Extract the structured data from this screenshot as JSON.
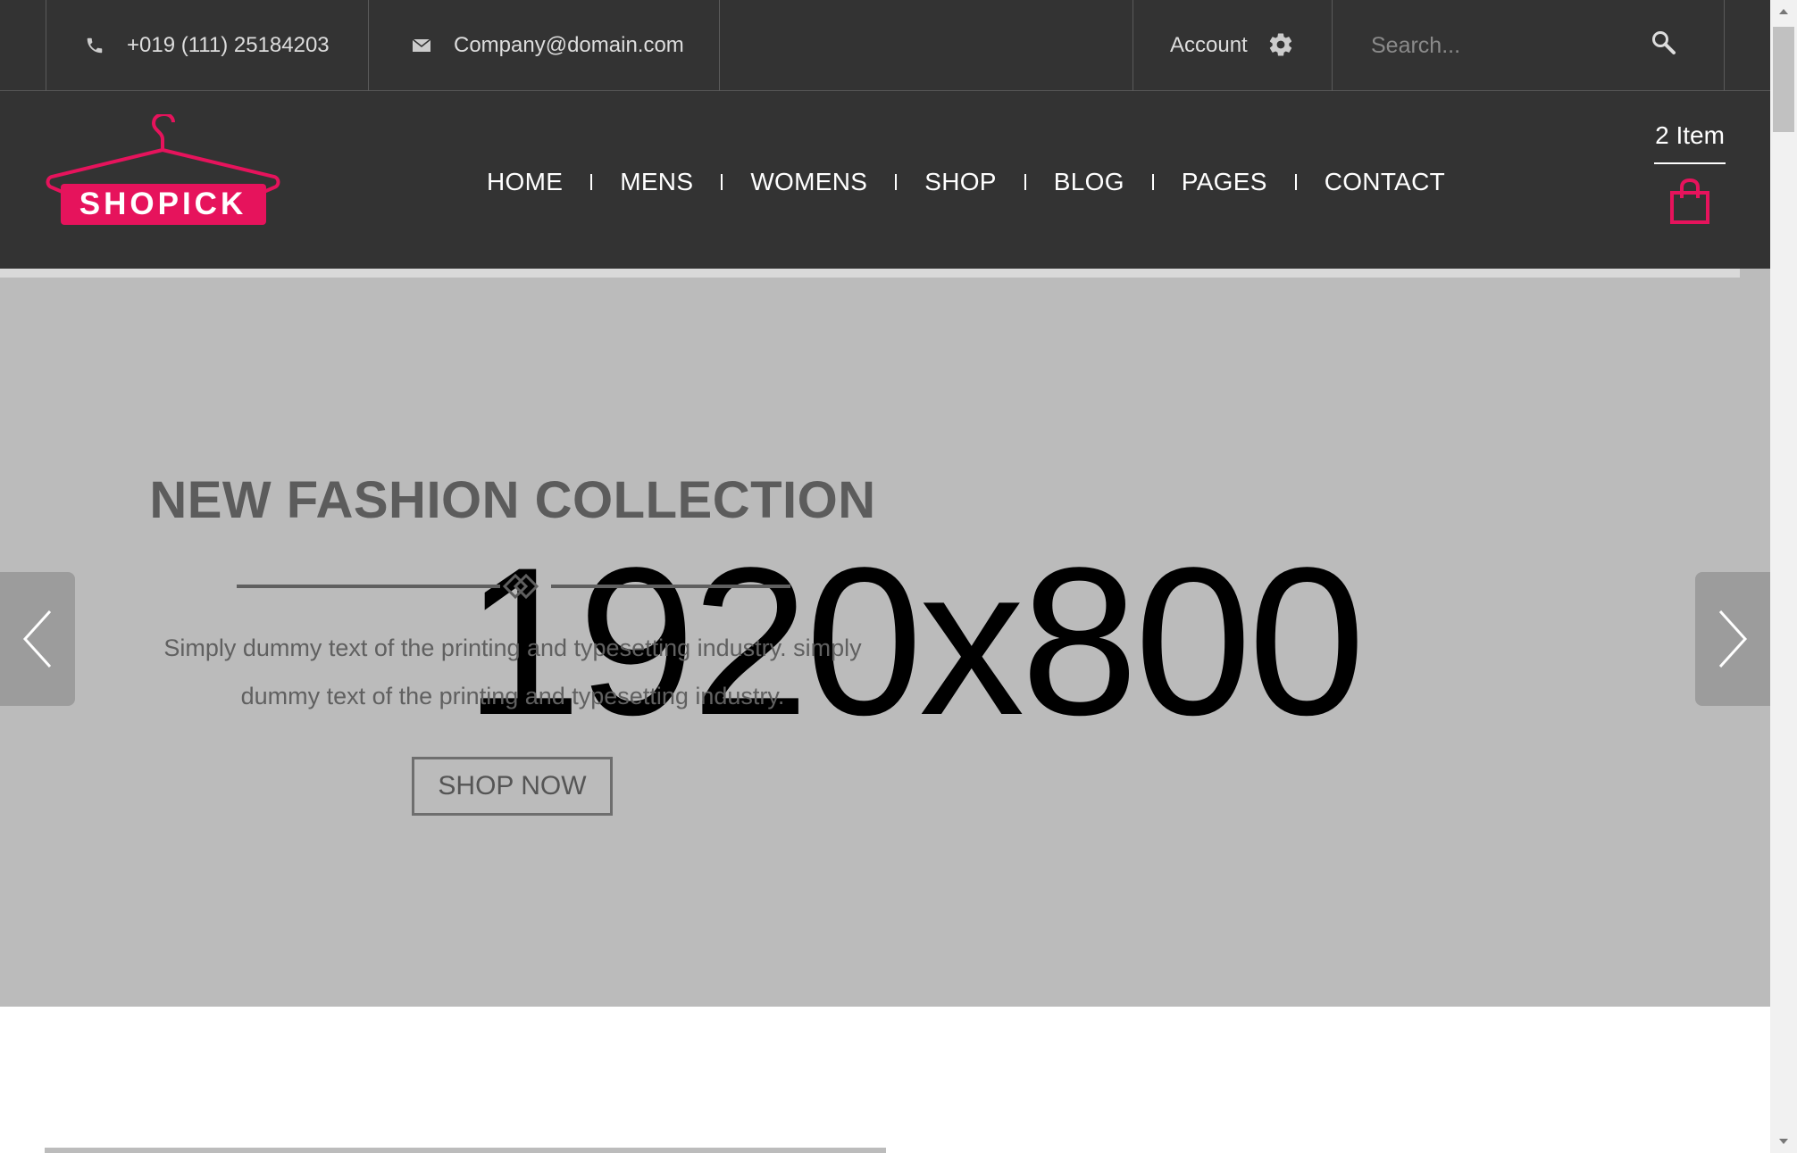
{
  "topbar": {
    "phone": "+019 (111) 25184203",
    "email": "Company@domain.com",
    "account_label": "Account",
    "search_placeholder": "Search..."
  },
  "header": {
    "logo_text": "SHOPICK",
    "nav": [
      "HOME",
      "MENS",
      "WOMENS",
      "SHOP",
      "BLOG",
      "PAGES",
      "CONTACT"
    ],
    "cart_count": "2 Item"
  },
  "slider": {
    "placeholder_text": "1920x800",
    "title": "NEW FASHION COLLECTION",
    "text": "Simply dummy text of the printing and typesetting industry. simply dummy text of the printing and typesetting industry.",
    "button_label": "SHOP NOW"
  },
  "colors": {
    "brand": "#e6135c",
    "dark_bg": "#333333",
    "slider_bg": "#bbbbbb"
  },
  "icons": [
    "phone-icon",
    "mail-icon",
    "gear-icon",
    "search-icon",
    "shopping-bag-icon",
    "chevron-left-icon",
    "chevron-right-icon"
  ]
}
